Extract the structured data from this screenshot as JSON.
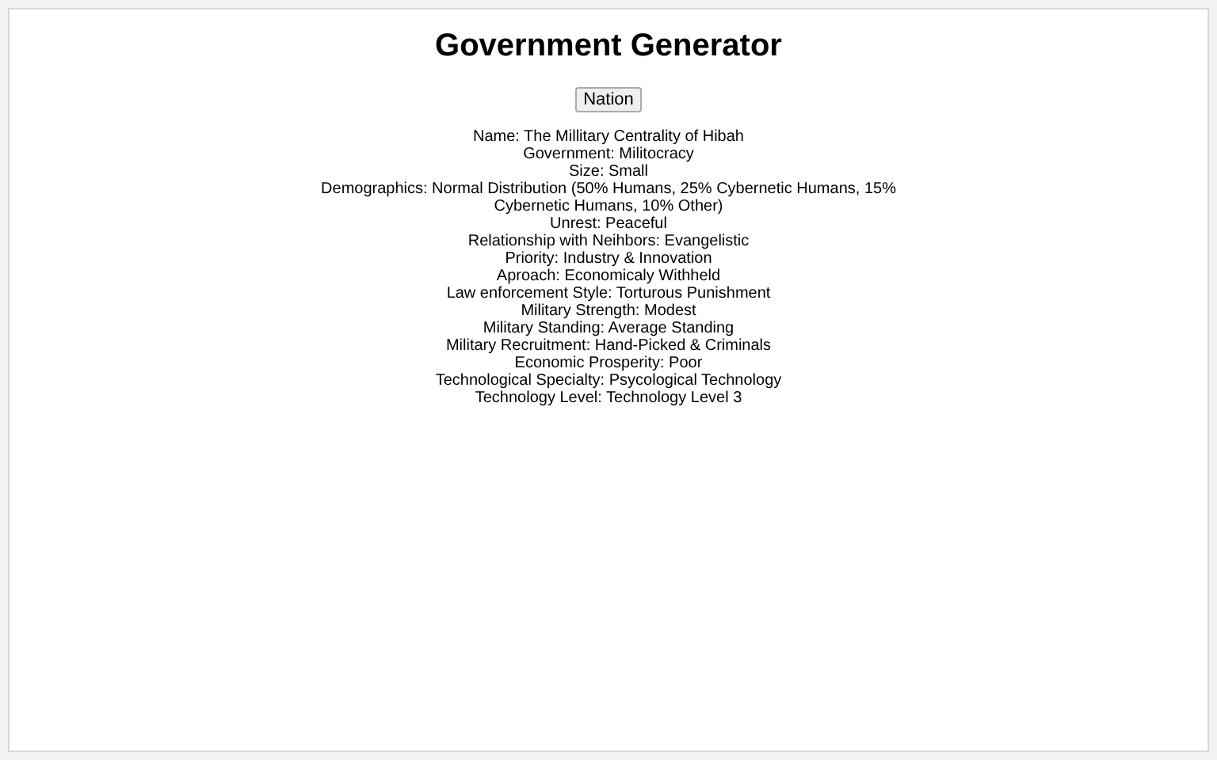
{
  "title": "Government Generator",
  "button": "Nation",
  "lines": [
    "Name: The Millitary Centrality of Hibah",
    "Government: Militocracy",
    "Size: Small",
    "Demographics: Normal Distribution (50% Humans, 25% Cybernetic Humans, 15% Cybernetic Humans, 10% Other)",
    "Unrest: Peaceful",
    "Relationship with Neihbors: Evangelistic",
    "Priority: Industry & Innovation",
    "Aproach: Economicaly Withheld",
    "Law enforcement Style: Torturous Punishment",
    "Military Strength: Modest",
    "Military Standing: Average Standing",
    "Military Recruitment: Hand-Picked & Criminals",
    "Economic Prosperity: Poor",
    "Technological Specialty: Psycological Technology",
    "Technology Level: Technology Level 3"
  ]
}
